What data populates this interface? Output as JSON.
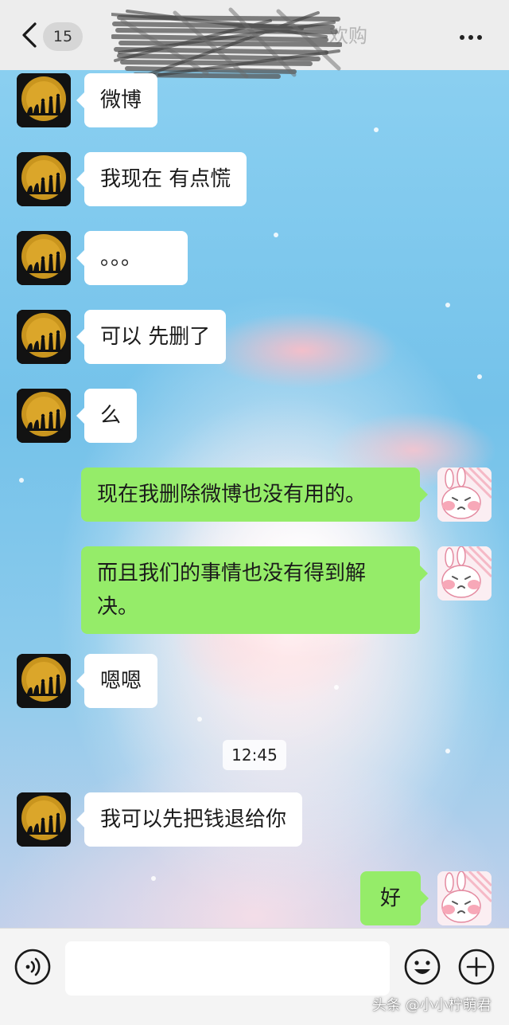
{
  "header": {
    "back_icon": "chevron-left-icon",
    "unread_count": "15",
    "title": "欢购",
    "more_icon": "more-dots-icon"
  },
  "messages": [
    {
      "sender": "contact",
      "text": "微博"
    },
    {
      "sender": "contact",
      "text": "我现在 有点慌"
    },
    {
      "sender": "contact",
      "text": "。。。"
    },
    {
      "sender": "contact",
      "text": "可以 先删了"
    },
    {
      "sender": "contact",
      "text": "么"
    },
    {
      "sender": "me",
      "text": "现在我删除微博也没有用的。"
    },
    {
      "sender": "me",
      "text": "而且我们的事情也没有得到解决。"
    },
    {
      "sender": "contact",
      "text": "嗯嗯"
    },
    {
      "timestamp": "12:45"
    },
    {
      "sender": "contact",
      "text": "我可以先把钱退给你"
    },
    {
      "sender": "me",
      "text": "好"
    }
  ],
  "input_bar": {
    "voice_icon": "voice-icon",
    "input_value": "",
    "emoji_icon": "emoji-icon",
    "add_icon": "plus-icon"
  },
  "watermark": "头条 @小小柠萌君",
  "colors": {
    "nav_bg": "#ededed",
    "incoming_bubble": "#ffffff",
    "outgoing_bubble": "#95ec69",
    "input_bar_bg": "#f4f4f4"
  }
}
